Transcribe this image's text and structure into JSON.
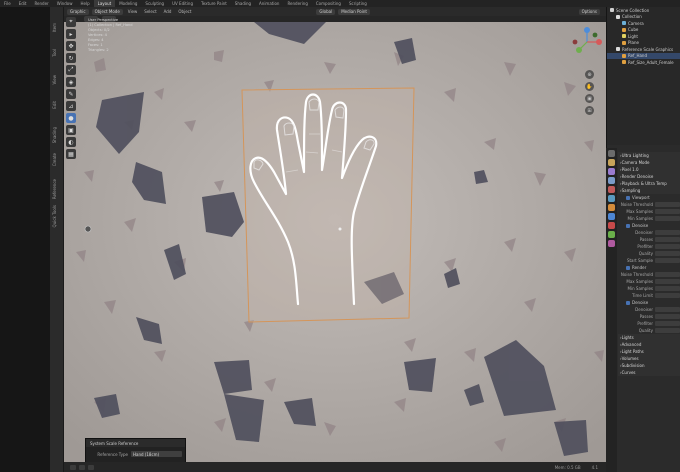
{
  "topbar": {
    "tabs": [
      "File",
      "Edit",
      "Render",
      "Window",
      "Help",
      "Layout",
      "Modeling",
      "Sculpting",
      "UV Editing",
      "Texture Paint",
      "Shading",
      "Animation",
      "Rendering",
      "Compositing",
      "Scripting"
    ],
    "active_tab": "Layout"
  },
  "viewport_header": {
    "editor_type": "Graphic",
    "mode": "Object Mode",
    "menus": [
      "View",
      "Select",
      "Add",
      "Object"
    ],
    "orientation": "Global",
    "pivot": "Median Point",
    "options_label": "Options"
  },
  "viewport_overlay": {
    "lines": [
      "User Perspective",
      "(1) Collection | Ref_Hand",
      "Objects: 0/2",
      "Vertices: 4",
      "Edges: 4",
      "Faces: 1",
      "Triangles: 2"
    ]
  },
  "vertical_tabs": [
    "Item",
    "Tool",
    "View",
    "Edit",
    "Shading",
    "Create",
    "Reference",
    "Quick Tools"
  ],
  "tools": [
    "cursor",
    "move",
    "rotate",
    "scale",
    "transform",
    "annotate",
    "measure",
    "cube",
    "extrude",
    "light"
  ],
  "scene_reference_panel": {
    "title": "System Scale Reference",
    "field_label": "Reference Type",
    "field_value": "Hand (18cm)"
  },
  "outliner": {
    "rows": [
      {
        "label": "Scene Collection",
        "indent": 0
      },
      {
        "label": "Collection",
        "indent": 1
      },
      {
        "label": "Camera",
        "indent": 2
      },
      {
        "label": "Cube",
        "indent": 2
      },
      {
        "label": "Light",
        "indent": 2
      },
      {
        "label": "Plane",
        "indent": 2
      },
      {
        "label": "Reference Scale Graphics",
        "indent": 1
      },
      {
        "label": "Ref_Hand",
        "indent": 2,
        "selected": true
      },
      {
        "label": "Ref_Size_Adult_Female",
        "indent": 2
      }
    ]
  },
  "properties": {
    "rows": [
      {
        "type": "hdr",
        "text": "Ultra Lighting"
      },
      {
        "type": "hdr",
        "text": "Camera Mode"
      },
      {
        "type": "hdr",
        "text": "Pixel 1.0"
      },
      {
        "type": "hdr",
        "text": "Render Denoise"
      },
      {
        "type": "hdr",
        "text": "Playback & Ultra Temp"
      },
      {
        "type": "hdr",
        "text": "Sampling"
      },
      {
        "type": "sub",
        "text": "Viewport"
      },
      {
        "type": "field",
        "text": "Noise Threshold"
      },
      {
        "type": "field",
        "text": "Max Samples"
      },
      {
        "type": "field",
        "text": "Min Samples"
      },
      {
        "type": "sub",
        "text": "Denoise"
      },
      {
        "type": "field",
        "text": "Denoiser"
      },
      {
        "type": "field",
        "text": "Passes"
      },
      {
        "type": "field",
        "text": "Prefilter"
      },
      {
        "type": "field",
        "text": "Quality"
      },
      {
        "type": "field",
        "text": "Start Sample"
      },
      {
        "type": "sub",
        "text": "Render"
      },
      {
        "type": "field",
        "text": "Noise Threshold"
      },
      {
        "type": "field",
        "text": "Max Samples"
      },
      {
        "type": "field",
        "text": "Min Samples"
      },
      {
        "type": "field",
        "text": "Time Limit"
      },
      {
        "type": "sub",
        "text": "Denoise"
      },
      {
        "type": "field",
        "text": "Denoiser"
      },
      {
        "type": "field",
        "text": "Passes"
      },
      {
        "type": "field",
        "text": "Prefilter"
      },
      {
        "type": "field",
        "text": "Quality"
      },
      {
        "type": "hdr",
        "text": "Lights"
      },
      {
        "type": "hdr",
        "text": "Advanced"
      },
      {
        "type": "hdr",
        "text": "Light Paths"
      },
      {
        "type": "hdr",
        "text": "Volumes"
      },
      {
        "type": "hdr",
        "text": "Subdivision"
      },
      {
        "type": "hdr",
        "text": "Curves"
      }
    ]
  },
  "statusbar": {
    "version": "4.1",
    "memory": "Mem: 0.5 GB"
  },
  "colors": {
    "accent": "#4772b3",
    "selection_box": "#d4955a",
    "hand_outline": "#ffffff"
  }
}
